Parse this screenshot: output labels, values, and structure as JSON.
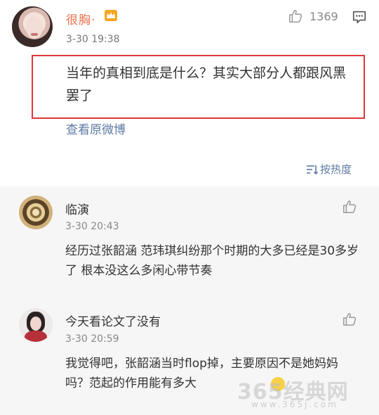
{
  "main_comment": {
    "username": "很胸·",
    "timestamp": "3-30 19:38",
    "like_count": "1369",
    "text": "当年的真相到底是什么？其实大部分人都跟风黑罢了",
    "view_original_label": "查看原微博"
  },
  "sort_label": "按热度",
  "replies": [
    {
      "username": "临演",
      "timestamp": "3-30 20:43",
      "text": "经历过张韶涵 范玮琪纠纷那个时期的大多已经是30多岁了 根本没这么多闲心带节奏"
    },
    {
      "username": "今天看论文了没有",
      "timestamp": "3-30 20:59",
      "text": "我觉得吧，张韶涵当时flop掉，主要原因不是她妈妈吗？范起的作用能有多大"
    }
  ],
  "watermark": {
    "text": "365经典网",
    "url": "www.365j.com"
  },
  "colors": {
    "username_accent": "#eb7350",
    "link_blue": "#5d7aa3",
    "highlight_red": "#e0363a",
    "reply_bg": "#f6f6f6"
  },
  "icons": {
    "vip": "crown-badge-icon",
    "like": "thumb-up-icon",
    "reply": "comment-bubble-icon",
    "sort": "sort-icon"
  }
}
